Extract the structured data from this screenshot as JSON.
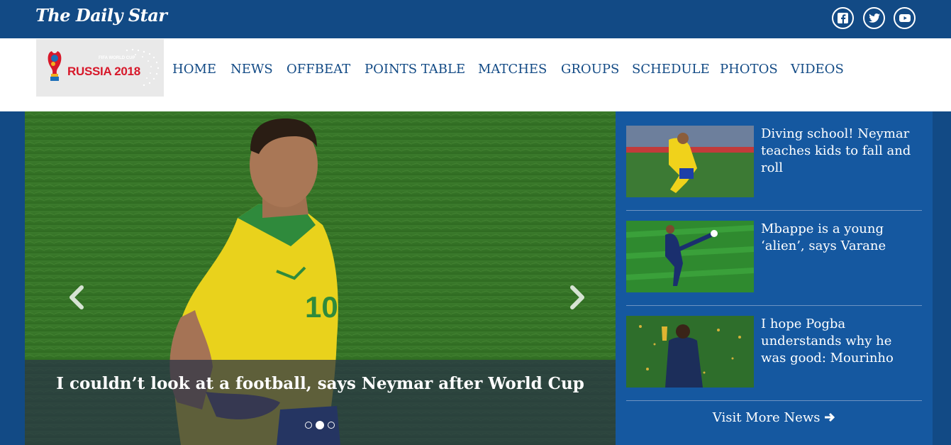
{
  "header": {
    "brand": "The Daily Star",
    "social": [
      "facebook-icon",
      "twitter-icon",
      "youtube-icon"
    ]
  },
  "nav": {
    "logo": {
      "text": "RUSSIA 2018",
      "sub": "FIFA WORLD CUP"
    },
    "items": [
      "HOME",
      "NEWS",
      "OFFBEAT",
      "POINTS TABLE",
      "MATCHES",
      "GROUPS",
      "SCHEDULE",
      "PHOTOS",
      "VIDEOS"
    ]
  },
  "slider": {
    "caption": "I couldn’t look at a football, says Neymar after World Cup",
    "prev_icon": "chevron-left-icon",
    "next_icon": "chevron-right-icon",
    "dots_count": 3,
    "active_dot": 2
  },
  "sidebar": {
    "items": [
      {
        "title": "Diving school! Neymar teaches kids to fall and roll"
      },
      {
        "title": "Mbappe is a young ‘alien’, says Varane"
      },
      {
        "title": "I hope Pogba understands why he was good: Mourinho"
      }
    ],
    "more_label": "Visit More News"
  },
  "colors": {
    "brand_blue": "#124a85",
    "sidebar_blue": "#1558a0",
    "logo_red": "#d7182a"
  }
}
